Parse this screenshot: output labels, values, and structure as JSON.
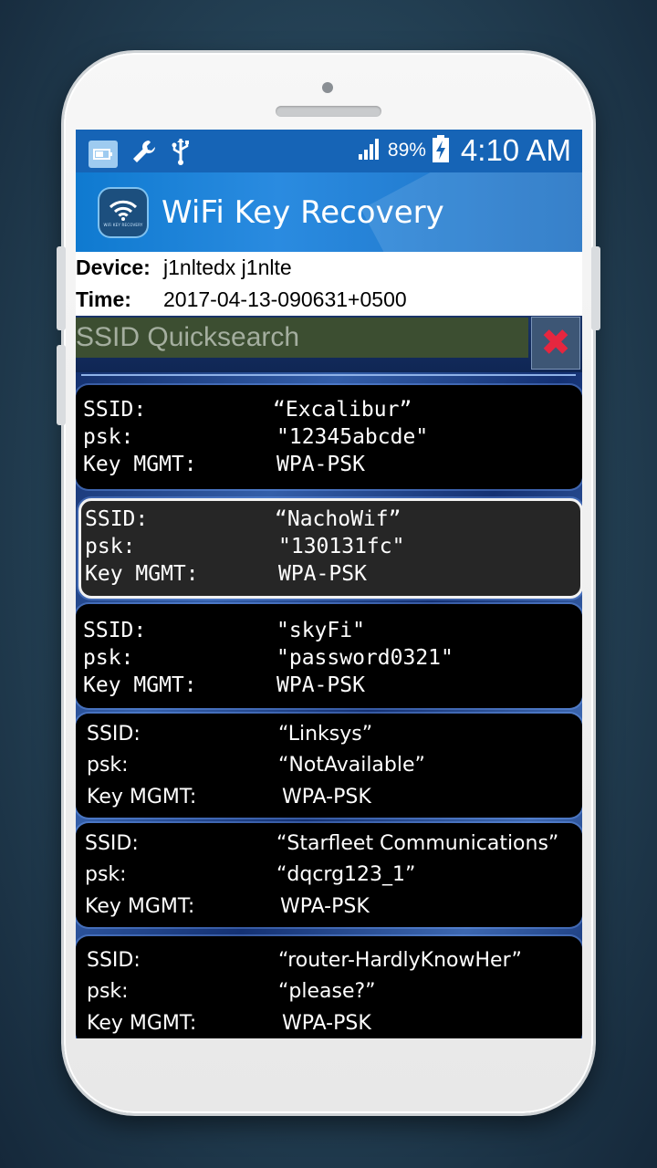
{
  "status_bar": {
    "left_icons": [
      "battery-saver-icon",
      "wrench-icon",
      "usb-icon"
    ],
    "signal_icon": "signal-bars-icon",
    "battery_percent": "89%",
    "battery_icon": "battery-charging-icon",
    "time": "4:10 AM"
  },
  "app_bar": {
    "title": "WiFi Key Recovery",
    "logo_icon": "wifi-logo-icon",
    "logo_caption": "WiFi KEY RECOVERY"
  },
  "device_info": {
    "device_label": "Device:",
    "device_value": "j1nltedx j1nlte",
    "time_label": "Time:",
    "time_value": "2017-04-13-090631+0500"
  },
  "search": {
    "placeholder": "SSID Quicksearch",
    "clear_icon": "close-x-icon"
  },
  "networks": [
    {
      "ssid_label": "SSID:",
      "ssid": "“Excalibur”",
      "psk_label": "psk:",
      "psk": "\"12345abcde\"",
      "mgmt_label": "Key MGMT:",
      "mgmt": "WPA-PSK"
    },
    {
      "ssid_label": "SSID:",
      "ssid": "“NachoWif”",
      "psk_label": "psk:",
      "psk": "\"130131fc\"",
      "mgmt_label": "Key MGMT:",
      "mgmt": "WPA-PSK"
    },
    {
      "ssid_label": "SSID:",
      "ssid": "\"skyFi\"",
      "psk_label": "psk:",
      "psk": "\"password0321\"",
      "mgmt_label": "Key MGMT:",
      "mgmt": "WPA-PSK"
    },
    {
      "ssid_label": "SSID:",
      "ssid": "“Linksys”",
      "psk_label": "psk:",
      "psk": "“NotAvailable”",
      "mgmt_label": "Key MGMT:",
      "mgmt": "WPA-PSK"
    },
    {
      "ssid_label": "SSID:",
      "ssid": "“Starfleet Communications”",
      "psk_label": "psk:",
      "psk": "“dqcrg123_1”",
      "mgmt_label": "Key MGMT:",
      "mgmt": "WPA-PSK"
    },
    {
      "ssid_label": "SSID:",
      "ssid": "“router-HardlyKnowHer”",
      "psk_label": "psk:",
      "psk": "“please?”",
      "mgmt_label": "Key MGMT:",
      "mgmt": "WPA-PSK"
    }
  ]
}
